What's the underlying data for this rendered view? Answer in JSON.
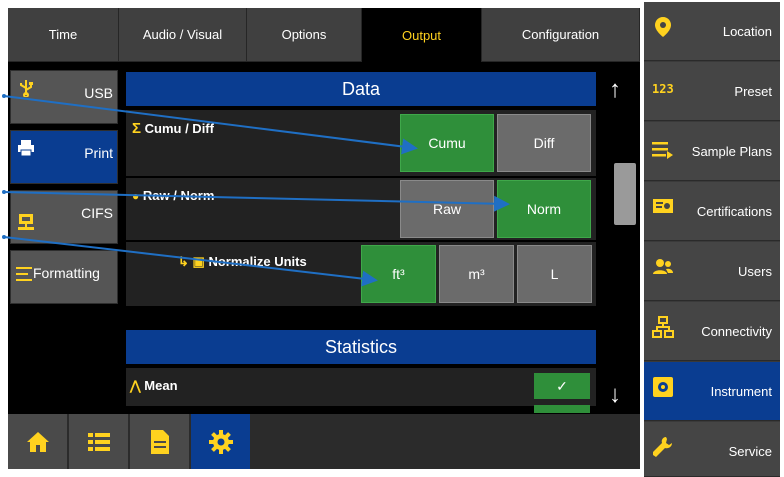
{
  "tabs": [
    {
      "label": "Time"
    },
    {
      "label": "Audio / Visual"
    },
    {
      "label": "Options"
    },
    {
      "label": "Output"
    },
    {
      "label": "Configuration"
    }
  ],
  "active_tab": "Output",
  "submenu": [
    {
      "label": "USB"
    },
    {
      "label": "Print"
    },
    {
      "label": "CIFS"
    },
    {
      "label": "Formatting"
    }
  ],
  "data_section": {
    "title": "Data",
    "cumu_diff": {
      "label": "Cumu / Diff",
      "options": [
        "Cumu",
        "Diff"
      ],
      "selected": "Cumu"
    },
    "raw_norm": {
      "label": "Raw / Norm",
      "options": [
        "Raw",
        "Norm"
      ],
      "selected": "Norm"
    },
    "normalize_units": {
      "label": "Normalize Units",
      "options": [
        "ft³",
        "m³",
        "L"
      ],
      "selected": "ft³"
    }
  },
  "statistics_section": {
    "title": "Statistics",
    "mean": {
      "label": "Mean",
      "checked": true,
      "check_glyph": "✓"
    }
  },
  "scroll": {
    "up": "↑",
    "down": "↓"
  },
  "right_nav": [
    {
      "label": "Location",
      "icon": "location-pin-icon"
    },
    {
      "label": "Preset",
      "icon": "123-icon",
      "icon_text": "123"
    },
    {
      "label": "Sample Plans",
      "icon": "list-arrow-icon"
    },
    {
      "label": "Certifications",
      "icon": "certificate-icon"
    },
    {
      "label": "Users",
      "icon": "users-icon"
    },
    {
      "label": "Connectivity",
      "icon": "network-icon"
    },
    {
      "label": "Instrument",
      "icon": "instrument-icon"
    },
    {
      "label": "Service",
      "icon": "wrench-icon"
    }
  ],
  "colors": {
    "accent_yellow": "#ffd21f",
    "active_blue": "#0a3d91",
    "selected_green": "#2f8f3a",
    "callout_line": "#1f6fc4"
  }
}
